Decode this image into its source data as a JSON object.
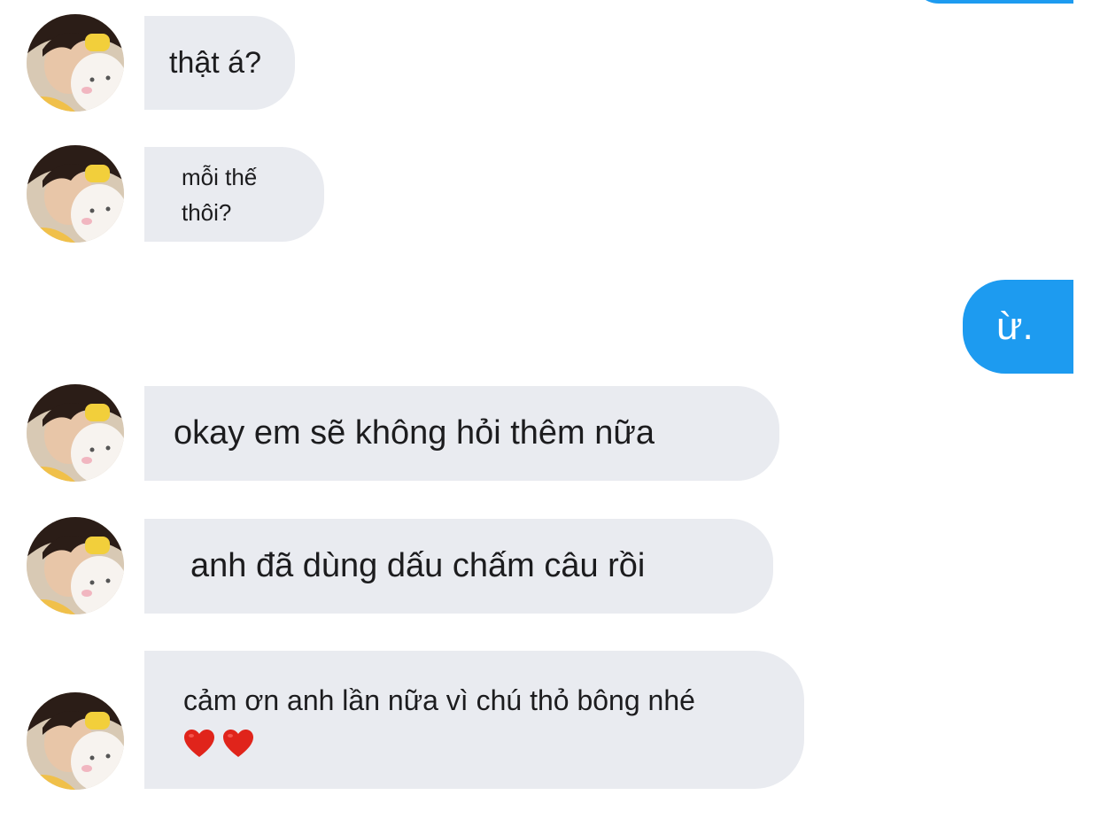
{
  "conversation": {
    "messages": [
      {
        "from": "them",
        "text": "thật á?"
      },
      {
        "from": "them",
        "line1": "mỗi thế",
        "line2": "thôi?"
      },
      {
        "from": "me",
        "text": "ừ."
      },
      {
        "from": "them",
        "text": "okay em sẽ không hỏi thêm nữa"
      },
      {
        "from": "them",
        "text": "anh đã dùng dấu chấm câu rồi"
      },
      {
        "from": "them",
        "text": "cảm ơn anh lần nữa vì chú thỏ bông nhé",
        "emoji": [
          "red-heart",
          "red-heart"
        ]
      }
    ]
  },
  "colors": {
    "incoming_bubble": "#e9ebf0",
    "outgoing_bubble": "#1d9bf0",
    "heart": "#e0241b"
  },
  "icons": {
    "avatar": "profile-photo-with-plush-rabbit",
    "emoji": "red-heart"
  }
}
